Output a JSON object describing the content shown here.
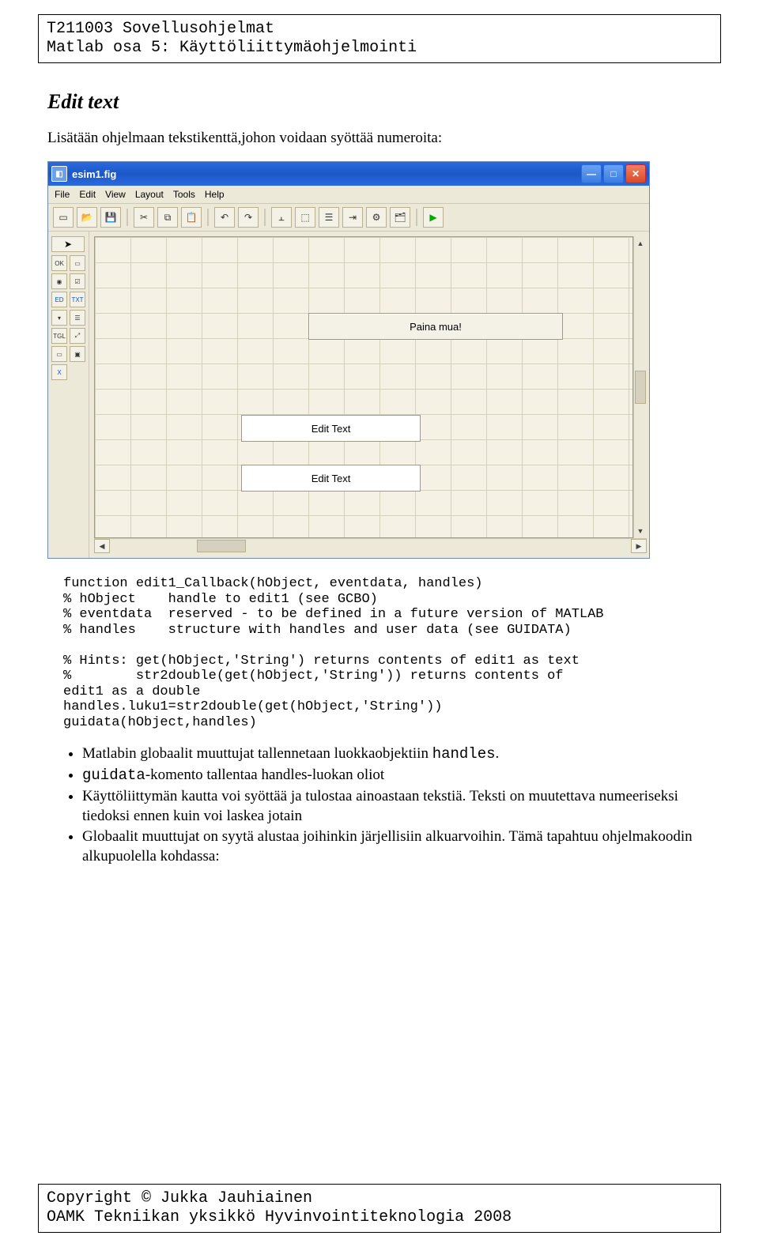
{
  "header": {
    "line1": "T211003 Sovellusohjelmat",
    "line2": "Matlab osa 5: Käyttöliittymäohjelmointi"
  },
  "section_title": "Edit text",
  "intro": "Lisätään ohjelmaan tekstikenttä,johon voidaan syöttää numeroita:",
  "guide": {
    "title": "esim1.fig",
    "menubar": [
      "File",
      "Edit",
      "View",
      "Layout",
      "Tools",
      "Help"
    ],
    "toolbar": [
      "new",
      "open",
      "save",
      "cut",
      "copy",
      "paste",
      "undo",
      "redo",
      "align",
      "reorder",
      "menu-editor",
      "tab-order",
      "toolbar-editor",
      "run"
    ],
    "palette_tooltips": [
      "select",
      "push-button",
      "slider",
      "radio-button",
      "check-box",
      "edit-text",
      "static-text",
      "pop-up-menu",
      "listbox",
      "toggle-button",
      "axes",
      "panel",
      "button-group",
      "activex"
    ],
    "canvas": {
      "button_label": "Paina mua!",
      "edit1_label": "Edit Text",
      "edit2_label": "Edit Text"
    }
  },
  "code": "function edit1_Callback(hObject, eventdata, handles)\n% hObject    handle to edit1 (see GCBO)\n% eventdata  reserved - to be defined in a future version of MATLAB\n% handles    structure with handles and user data (see GUIDATA)\n\n% Hints: get(hObject,'String') returns contents of edit1 as text\n%        str2double(get(hObject,'String')) returns contents of\nedit1 as a double\nhandles.luku1=str2double(get(hObject,'String'))\nguidata(hObject,handles)",
  "bullets": {
    "b1_a": "Matlabin globaalit muuttujat tallennetaan luokkaobjektiin ",
    "b1_code": "handles",
    "b1_b": ".",
    "b2_code": "guidata",
    "b2_text": "-komento tallentaa handles-luokan oliot",
    "b3": "Käyttöliittymän kautta voi syöttää ja tulostaa ainoastaan tekstiä. Teksti on muutettava numeeriseksi tiedoksi ennen kuin voi laskea jotain",
    "b4": "Globaalit muuttujat on syytä alustaa joihinkin järjellisiin alkuarvoihin. Tämä tapahtuu ohjelmakoodin alkupuolella kohdassa:"
  },
  "footer": {
    "line1": "Copyright © Jukka Jauhiainen",
    "line2": "OAMK Tekniikan yksikkö Hyvinvointiteknologia 2008"
  }
}
